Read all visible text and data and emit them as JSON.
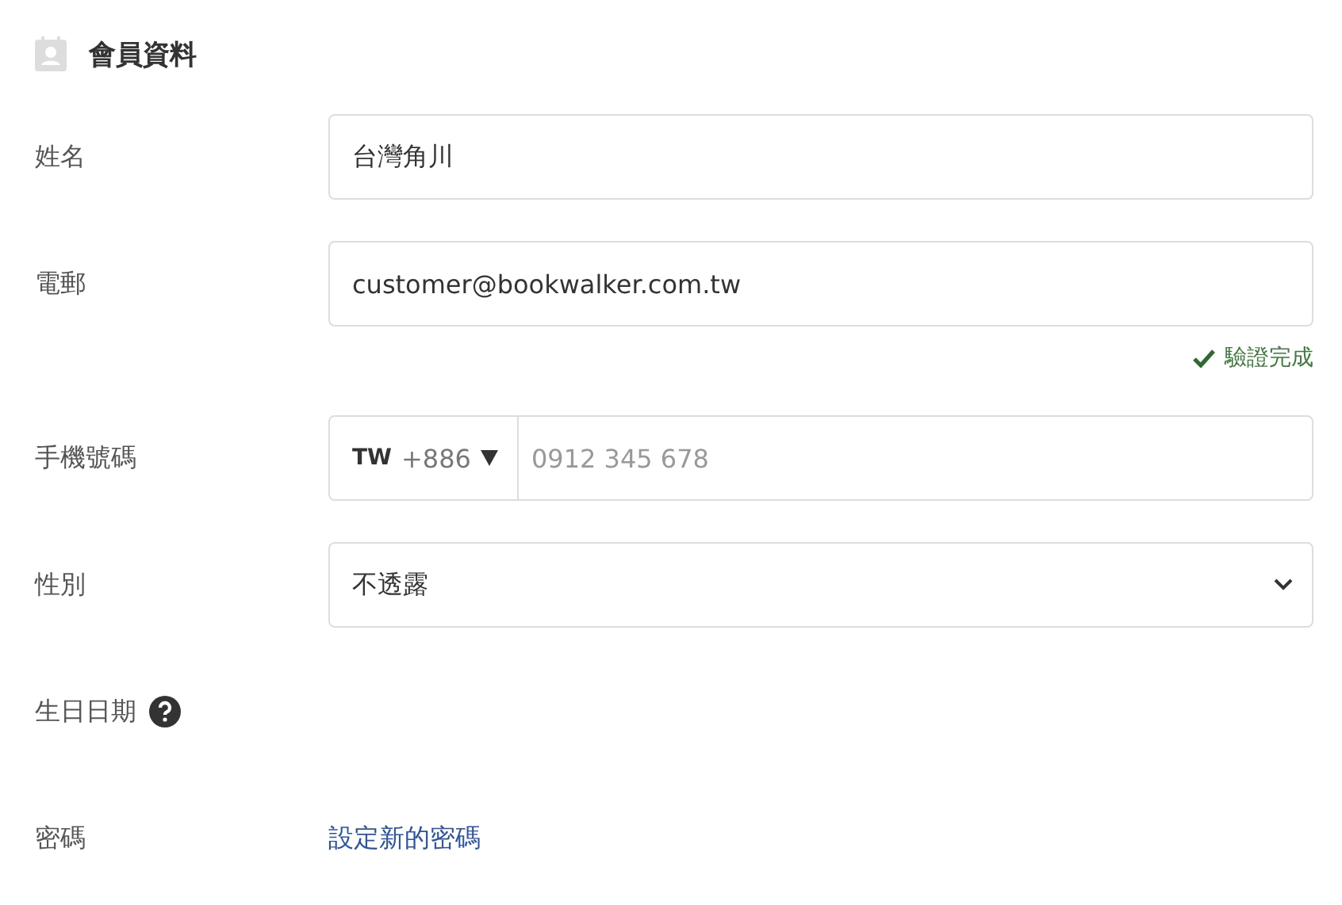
{
  "section": {
    "title": "會員資料"
  },
  "rows": [
    {
      "kind": "text",
      "label": "姓名",
      "value": "台灣角川"
    },
    {
      "kind": "text",
      "label": "電郵",
      "value": "customer@bookwalker.com.tw",
      "note": "驗證完成",
      "verified": true
    },
    {
      "kind": "phone",
      "label": "手機號碼",
      "country": "TW",
      "code": "+886",
      "placeholder": "0912 345 678"
    },
    {
      "kind": "select",
      "label": "性別",
      "value": "不透露"
    },
    {
      "kind": "help",
      "label": "生日日期"
    },
    {
      "kind": "link",
      "label": "密碼",
      "link": "設定新的密碼"
    }
  ]
}
